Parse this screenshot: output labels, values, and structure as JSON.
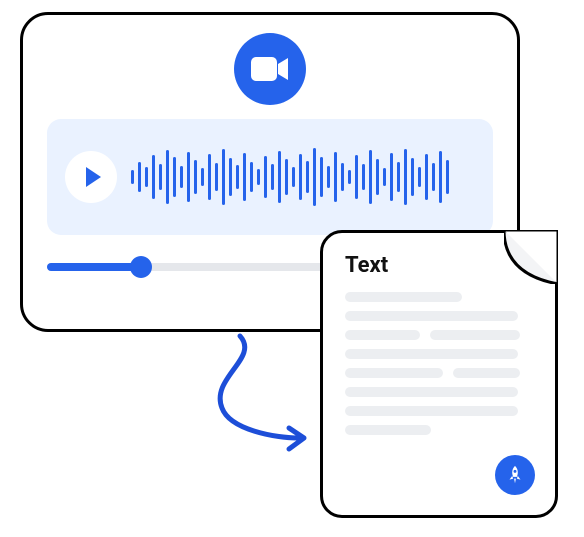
{
  "doc": {
    "title": "Text"
  },
  "icons": {
    "camera": "camera-icon",
    "play": "play-icon",
    "rocket": "rocket-icon"
  },
  "colors": {
    "accent": "#2563eb",
    "panel": "#eaf2ff",
    "line": "#eceef1"
  },
  "slider": {
    "progress_percent": 21
  },
  "waveform": {
    "bars": [
      14,
      30,
      20,
      44,
      26,
      54,
      40,
      22,
      50,
      34,
      18,
      46,
      28,
      56,
      38,
      24,
      48,
      30,
      16,
      42,
      26,
      52,
      36,
      20,
      46,
      32,
      58,
      40,
      22,
      50,
      28,
      14,
      44,
      26,
      54,
      36,
      18,
      48,
      30,
      56,
      38,
      20,
      46,
      28,
      52,
      34
    ]
  }
}
